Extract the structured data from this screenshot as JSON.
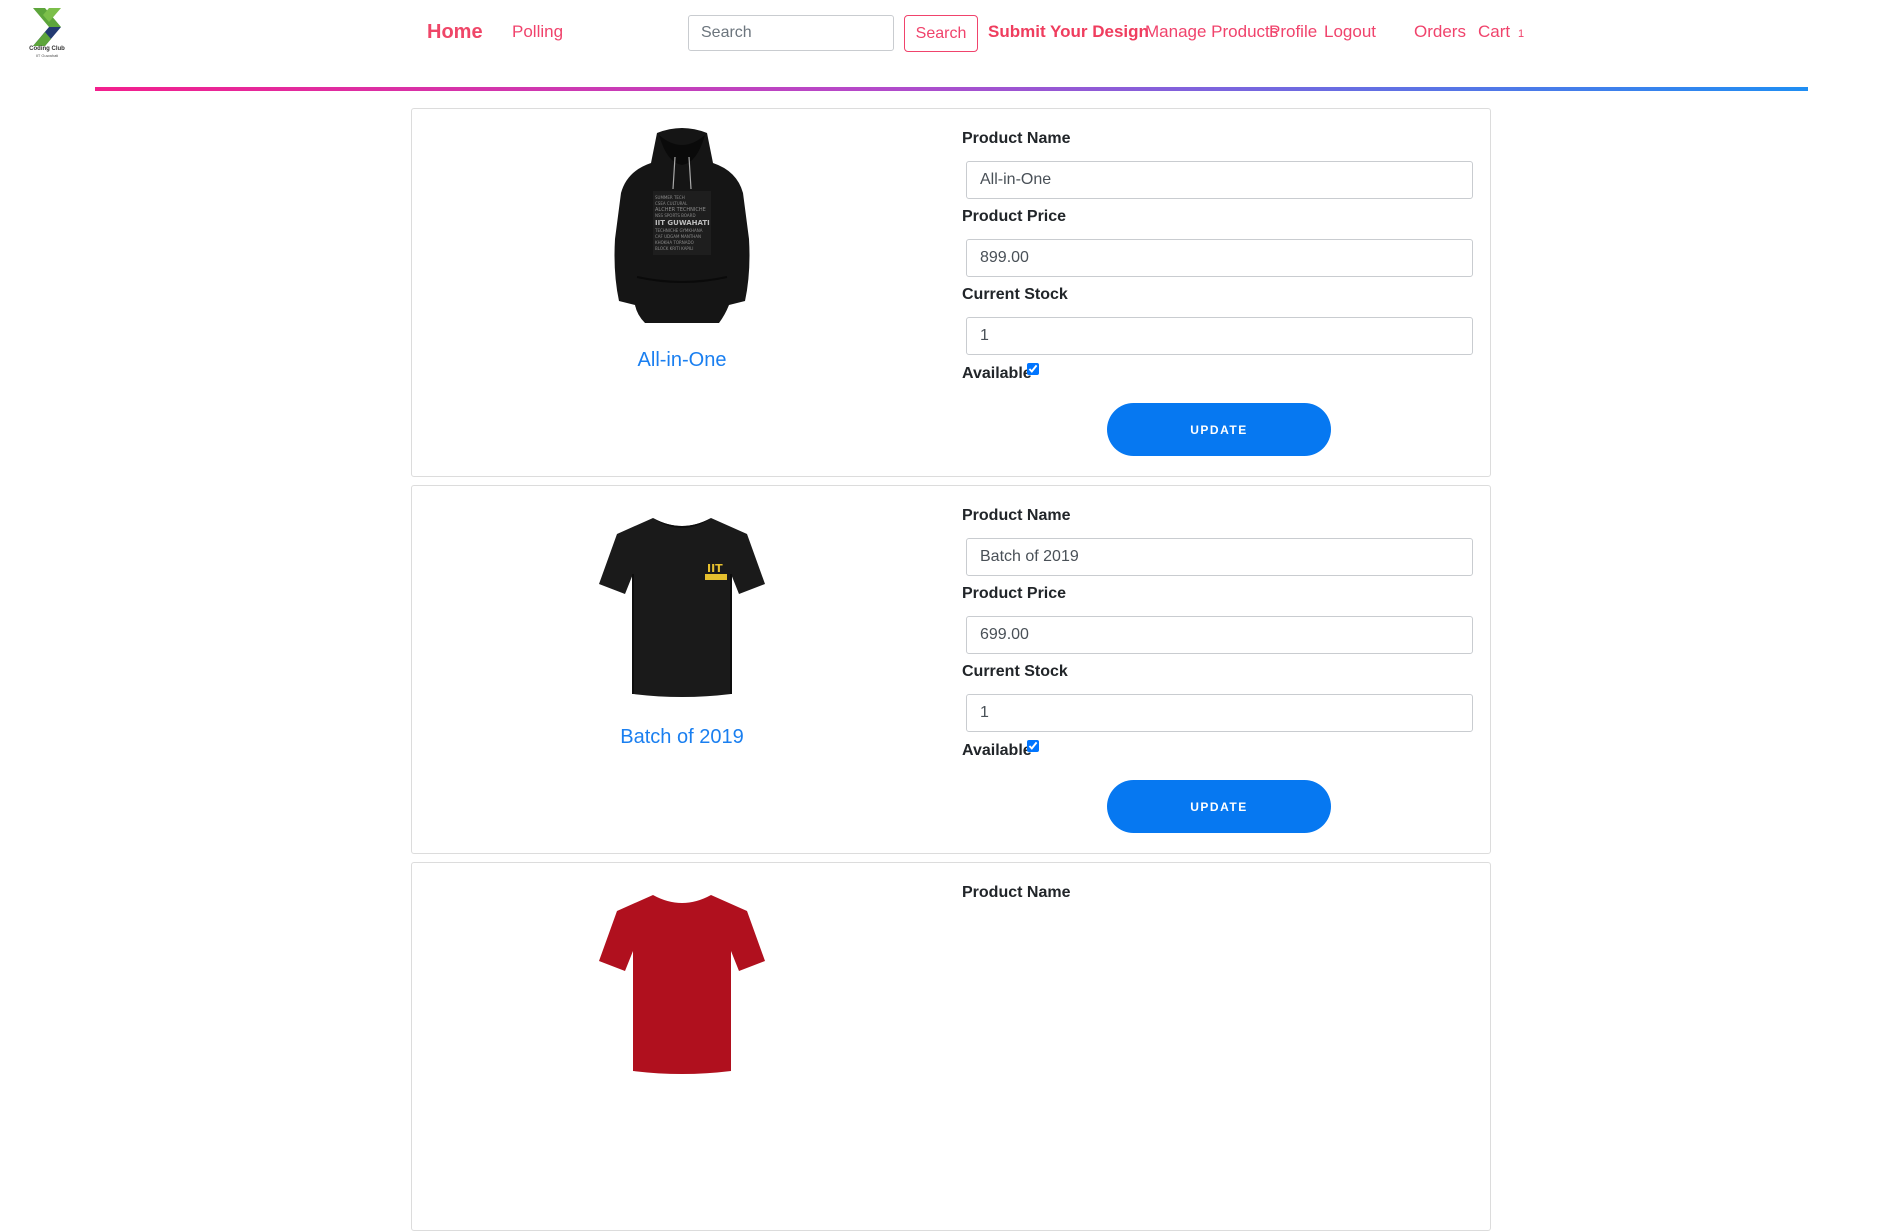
{
  "brand": {
    "logo_text": "Coding Club",
    "logo_subtext": "IIT Guwahati",
    "colors": {
      "green": "#5da53b",
      "navy": "#233a72",
      "accent": "#f0436c",
      "link_blue": "#1a7ff0",
      "button_blue": "#0678f1"
    }
  },
  "nav": {
    "home": "Home",
    "polling": "Polling",
    "search_placeholder": "Search",
    "search_button": "Search",
    "submit_design": "Submit Your Design",
    "manage_products": "Manage Products",
    "profile": "Profile",
    "logout": "Logout",
    "orders": "Orders",
    "cart": "Cart",
    "cart_count": "1"
  },
  "labels": {
    "product_name": "Product Name",
    "product_price": "Product Price",
    "current_stock": "Current Stock",
    "available": "Available",
    "update": "UPDATE"
  },
  "products": [
    {
      "title": "All-in-One",
      "name": "All-in-One",
      "price": "899.00",
      "stock": "1",
      "available": true,
      "image": "black-hoodie",
      "print_text": "IIT GUWAHATI"
    },
    {
      "title": "Batch of 2019",
      "name": "Batch of 2019",
      "price": "699.00",
      "stock": "1",
      "available": true,
      "image": "black-tshirt",
      "print_text": "IIT"
    },
    {
      "image": "red-tshirt"
    }
  ]
}
